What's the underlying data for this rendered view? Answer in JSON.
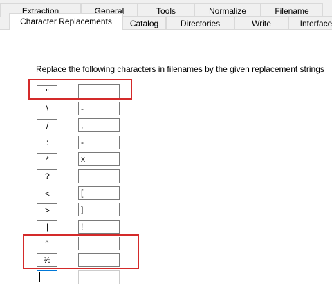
{
  "tabs_row1": [
    "Extraction",
    "General",
    "Tools",
    "Normalize",
    "Filename"
  ],
  "tabs_row2": [
    "Character Replacements",
    "Catalog",
    "Directories",
    "Write",
    "Interface"
  ],
  "active_tab": "Character Replacements",
  "instruction": "Replace the following characters in filenames by the given replacement strings",
  "replacements": [
    {
      "char": "\"",
      "value": ""
    },
    {
      "char": "\\",
      "value": "-"
    },
    {
      "char": "/",
      "value": ","
    },
    {
      "char": ":",
      "value": "-"
    },
    {
      "char": "*",
      "value": "x"
    },
    {
      "char": "?",
      "value": ""
    },
    {
      "char": "<",
      "value": "["
    },
    {
      "char": ">",
      "value": "]"
    },
    {
      "char": "|",
      "value": "!"
    },
    {
      "char": "^",
      "value": ""
    },
    {
      "char": "%",
      "value": ""
    },
    {
      "char": "",
      "value": ""
    }
  ],
  "highlight_color": "#d42a2a"
}
